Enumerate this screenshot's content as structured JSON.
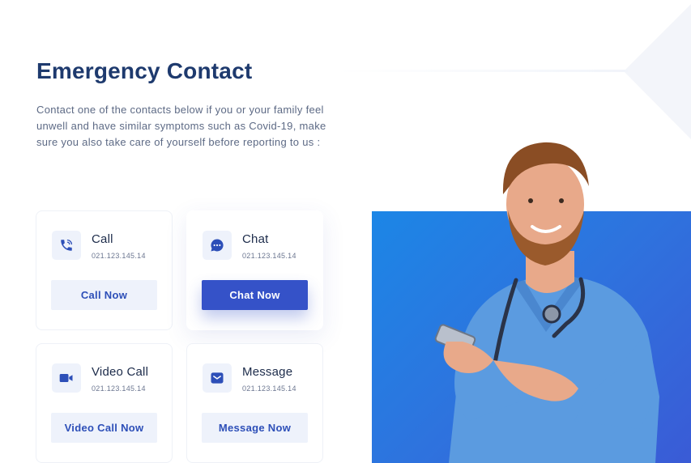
{
  "header": {
    "title": "Emergency Contact",
    "description": "Contact one of the contacts below if you or your family feel unwell and have similar symptoms such as Covid-19, make sure you also take care of yourself before reporting to us :"
  },
  "contacts": [
    {
      "name": "Call",
      "number": "021.123.145.14",
      "button_label": "Call Now",
      "icon": "phone-icon"
    },
    {
      "name": "Chat",
      "number": "021.123.145.14",
      "button_label": "Chat Now",
      "icon": "chat-bubble-icon"
    },
    {
      "name": "Video Call",
      "number": "021.123.145.14",
      "button_label": "Video Call Now",
      "icon": "video-camera-icon"
    },
    {
      "name": "Message",
      "number": "021.123.145.14",
      "button_label": "Message Now",
      "icon": "envelope-icon"
    }
  ],
  "colors": {
    "primary": "#3552c8",
    "title": "#1e3a6e",
    "body_text": "#5d6a85",
    "button_light_bg": "#eef2fb",
    "hero_gradient": [
      "#1c86e6",
      "#3a5bd6"
    ]
  }
}
